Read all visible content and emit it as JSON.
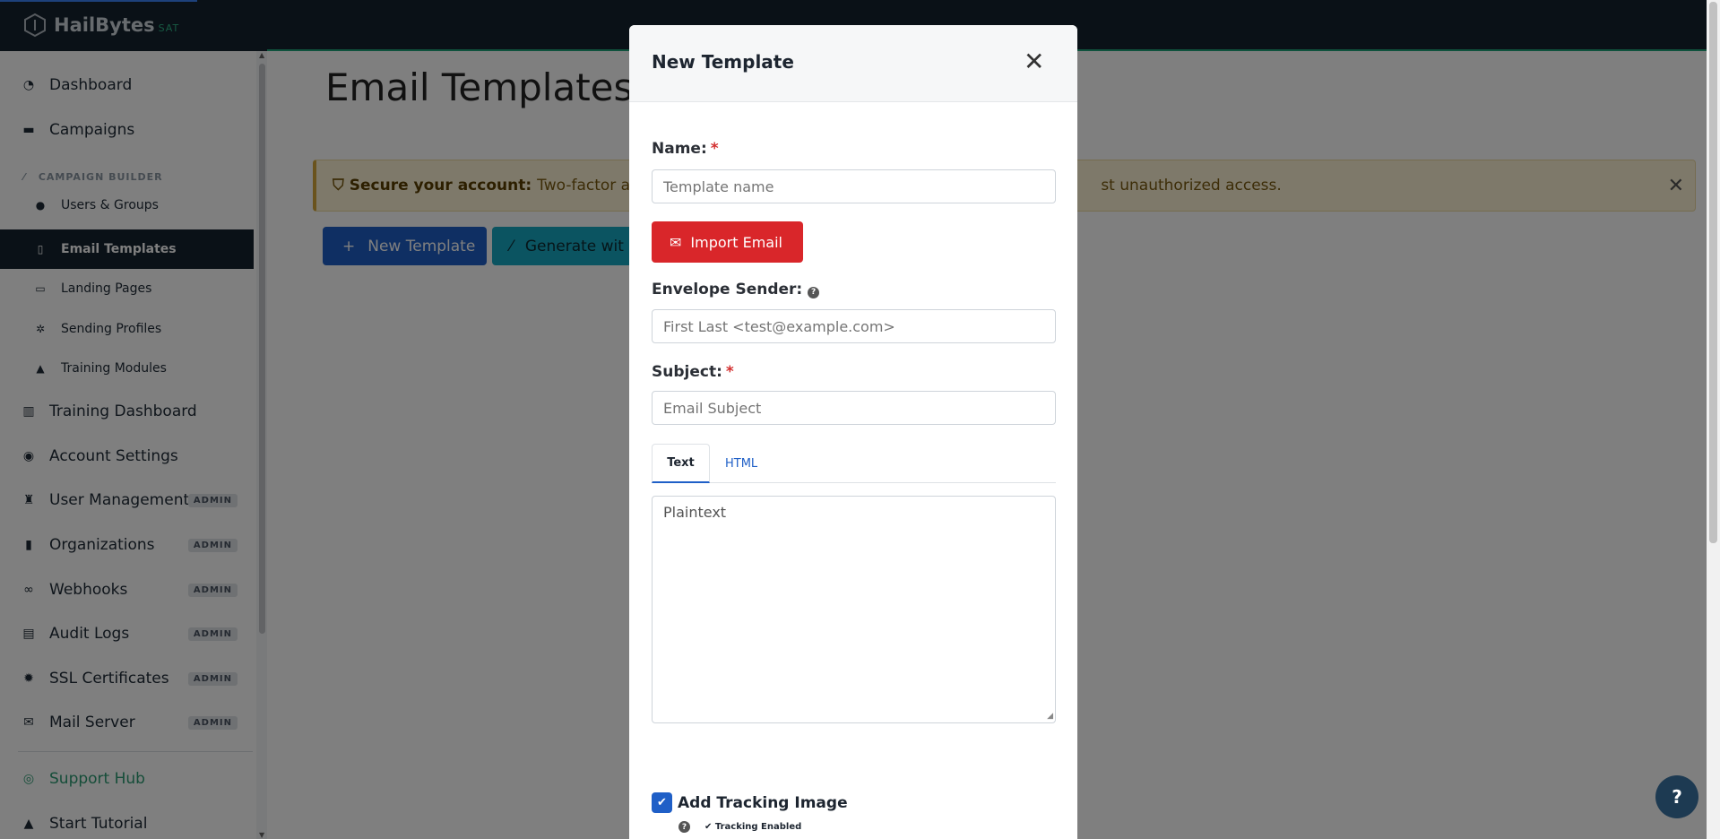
{
  "brand": {
    "name": "HailBytes",
    "suffix": "SAT"
  },
  "sidebar": {
    "items": [
      {
        "label": "Dashboard",
        "icon": "gauge-icon"
      },
      {
        "label": "Campaigns",
        "icon": "briefcase-icon"
      }
    ],
    "section_label": "CAMPAIGN BUILDER",
    "sub_items": [
      {
        "label": "Users & Groups",
        "icon": "users-icon"
      },
      {
        "label": "Email Templates",
        "icon": "file-icon",
        "active": true
      },
      {
        "label": "Landing Pages",
        "icon": "monitor-icon"
      },
      {
        "label": "Sending Profiles",
        "icon": "gear-icon"
      },
      {
        "label": "Training Modules",
        "icon": "graduation-cap-icon"
      }
    ],
    "lower_items": [
      {
        "label": "Training Dashboard",
        "icon": "bar-chart-icon"
      },
      {
        "label": "Account Settings",
        "icon": "user-circle-icon"
      },
      {
        "label": "User Management",
        "icon": "user-lock-icon",
        "badge": "ADMIN"
      },
      {
        "label": "Organizations",
        "icon": "building-icon",
        "badge": "ADMIN"
      },
      {
        "label": "Webhooks",
        "icon": "link-icon",
        "badge": "ADMIN"
      },
      {
        "label": "Audit Logs",
        "icon": "clipboard-icon",
        "badge": "ADMIN"
      },
      {
        "label": "SSL Certificates",
        "icon": "certificate-icon",
        "badge": "ADMIN"
      },
      {
        "label": "Mail Server",
        "icon": "envelope-icon",
        "badge": "ADMIN"
      }
    ],
    "support": "Support Hub",
    "tutorial": "Start Tutorial"
  },
  "main": {
    "title": "Email Templates",
    "alert_strong": "Secure your account:",
    "alert_text_left": "Two-factor auth",
    "alert_text_right": "st unauthorized access.",
    "new_template": "New Template",
    "generate": "Generate wit"
  },
  "modal": {
    "title": "New Template",
    "name_label": "Name:",
    "name_placeholder": "Template name",
    "import_label": "Import Email",
    "envelope_label": "Envelope Sender:",
    "envelope_placeholder": "First Last <test@example.com>",
    "subject_label": "Subject:",
    "subject_placeholder": "Email Subject",
    "tab_text": "Text",
    "tab_html": "HTML",
    "body_placeholder": "Plaintext",
    "tracking_label": "Add Tracking Image",
    "tracking_status": "Tracking Enabled",
    "tracking_checked": true
  },
  "help_label": "?",
  "colors": {
    "topbar": "#14222e",
    "primary": "#1f5fc7",
    "danger": "#d9262a",
    "info": "#17a8c2",
    "support": "#2b9b72"
  }
}
